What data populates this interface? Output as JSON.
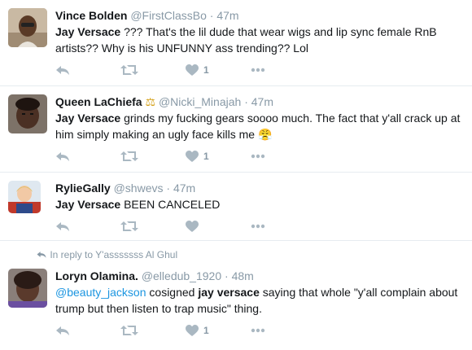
{
  "tweets": [
    {
      "name": "Vince Bolden",
      "handle": "@FirstClassBo",
      "dot": "·",
      "time": "47m",
      "lead": "Jay Versace",
      "text": " ??? That's the lil dude that wear wigs and lip sync female RnB artists?? Why is his UNFUNNY ass trending?? Lol",
      "like_count": "1"
    },
    {
      "name": "Queen LaChiefa",
      "badge": "⚖",
      "handle": "@Nicki_Minajah",
      "dot": "·",
      "time": "47m",
      "lead": "Jay Versace",
      "text": " grinds my fucking gears soooo much. The fact that y'all crack up at him simply making an ugly face kills me ",
      "emoji": "😤",
      "like_count": "1"
    },
    {
      "name": "RylieGally",
      "handle": "@shwevs",
      "dot": "·",
      "time": "47m",
      "lead": "Jay Versace",
      "text": " BEEN CANCELED"
    },
    {
      "reply_prefix": "In reply to ",
      "reply_to": "Y'asssssss Al Ghul",
      "name": "Loryn Olamina.",
      "handle": "@elledub_1920",
      "dot": "·",
      "time": "48m",
      "mention": "@beauty_jackson",
      "text_a": " cosigned ",
      "lead": "jay versace",
      "text_b": " saying that whole \"y'all complain about trump but then listen to trap music\" thing.",
      "like_count": "1"
    }
  ],
  "icons": {
    "reply": "reply-icon",
    "retweet": "retweet-icon",
    "like": "heart-icon",
    "more": "more-icon"
  },
  "colors": {
    "name": "#14171a",
    "meta": "#8899a6",
    "link": "#1b95e0",
    "action": "#aab8c2",
    "divider": "#e6ecf0"
  }
}
